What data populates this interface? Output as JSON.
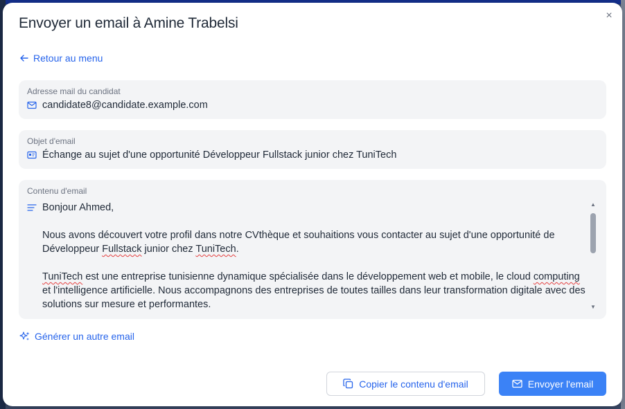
{
  "modal": {
    "title": "Envoyer un email à Amine Trabelsi",
    "close_label": "×",
    "back_label": "Retour au menu",
    "email_field": {
      "label": "Adresse mail du candidat",
      "value": "candidate8@candidate.example.com"
    },
    "subject_field": {
      "label": "Objet d'email",
      "value": "Échange au sujet d'une opportunité Développeur Fullstack junior chez TuniTech"
    },
    "content_field": {
      "label": "Contenu d'email",
      "greeting": "Bonjour Ahmed,",
      "p1_a": "Nous avons découvert votre profil dans notre CVthèque et souhaitions vous contacter au sujet d'une opportunité de Développeur ",
      "p1_spell1": "Fullstack",
      "p1_b": " junior chez ",
      "p1_spell2": "TuniTech",
      "p1_c": ".",
      "p2_spell1": "TuniTech",
      "p2_a": " est une entreprise tunisienne dynamique spécialisée dans le développement web et mobile, le cloud ",
      "p2_spell2": "computing",
      "p2_b": " et l'intelligence artificielle. Nous accompagnons des entreprises de toutes tailles dans leur transformation digitale avec des solutions sur mesure et performantes."
    },
    "generate_label": "Générer un autre email",
    "copy_button_label": "Copier le contenu d'email",
    "send_button_label": "Envoyer l'email"
  },
  "colors": {
    "accent": "#2563eb",
    "primary_button": "#3b82f6",
    "field_bg": "#f3f4f6"
  }
}
